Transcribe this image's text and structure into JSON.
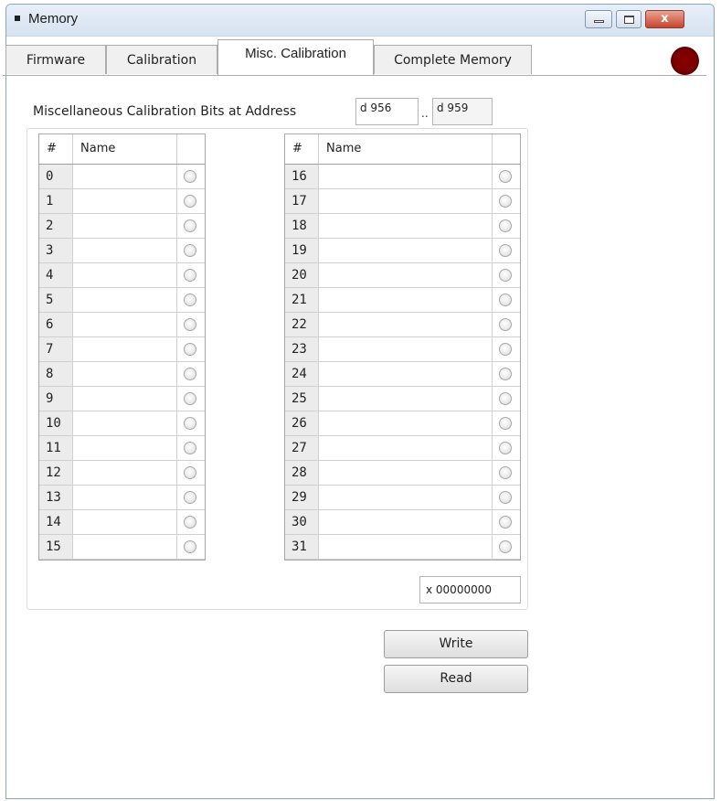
{
  "window": {
    "title": "Memory",
    "close_glyph": "x"
  },
  "tabs": [
    {
      "label": "Firmware"
    },
    {
      "label": "Calibration"
    },
    {
      "label": "Misc. Calibration"
    },
    {
      "label": "Complete Memory"
    }
  ],
  "status": {
    "color": "#7a0000"
  },
  "address": {
    "label": "Miscellaneous Calibration Bits at Address",
    "from": "d 956",
    "separator": "..",
    "to": "d 959"
  },
  "grid_left": {
    "headers": {
      "num": "#",
      "name": "Name"
    },
    "rows": [
      "0",
      "1",
      "2",
      "3",
      "4",
      "5",
      "6",
      "7",
      "8",
      "9",
      "10",
      "11",
      "12",
      "13",
      "14",
      "15"
    ]
  },
  "grid_right": {
    "headers": {
      "num": "#",
      "name": "Name"
    },
    "rows": [
      "16",
      "17",
      "18",
      "19",
      "20",
      "21",
      "22",
      "23",
      "24",
      "25",
      "26",
      "27",
      "28",
      "29",
      "30",
      "31"
    ]
  },
  "hex_value": "x 00000000",
  "buttons": {
    "write": "Write",
    "read": "Read"
  }
}
